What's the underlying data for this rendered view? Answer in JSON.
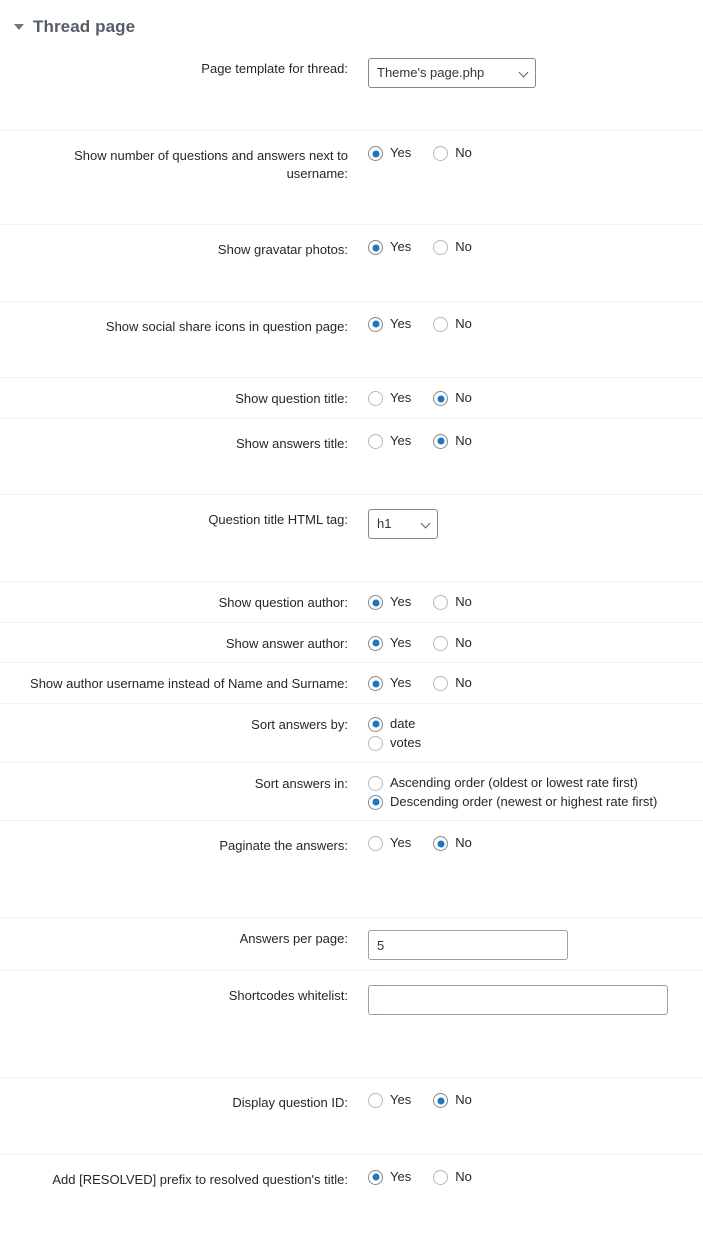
{
  "panel": {
    "title": "Thread page",
    "collapse_icon": "caret-down-icon"
  },
  "fields": {
    "page_template": {
      "label": "Page template for thread:",
      "value": "Theme's page.php",
      "options": [
        "Theme's page.php"
      ]
    },
    "show_counts": {
      "label": "Show number of questions and answers next to username:",
      "yes": "Yes",
      "no": "No",
      "selected": "Yes"
    },
    "show_gravatar": {
      "label": "Show gravatar photos:",
      "yes": "Yes",
      "no": "No",
      "selected": "Yes"
    },
    "show_social": {
      "label": "Show social share icons in question page:",
      "yes": "Yes",
      "no": "No",
      "selected": "Yes"
    },
    "show_question_title": {
      "label": "Show question title:",
      "yes": "Yes",
      "no": "No",
      "selected": "No"
    },
    "show_answers_title": {
      "label": "Show answers title:",
      "yes": "Yes",
      "no": "No",
      "selected": "No"
    },
    "title_tag": {
      "label": "Question title HTML tag:",
      "value": "h1",
      "options": [
        "h1"
      ]
    },
    "show_question_author": {
      "label": "Show question author:",
      "yes": "Yes",
      "no": "No",
      "selected": "Yes"
    },
    "show_answer_author": {
      "label": "Show answer author:",
      "yes": "Yes",
      "no": "No",
      "selected": "Yes"
    },
    "show_username": {
      "label": "Show author username instead of Name and Surname:",
      "yes": "Yes",
      "no": "No",
      "selected": "Yes"
    },
    "sort_answers_by": {
      "label": "Sort answers by:",
      "option_date": "date",
      "option_votes": "votes",
      "selected": "date"
    },
    "sort_answers_in": {
      "label": "Sort answers in:",
      "option_asc": "Ascending order (oldest or lowest rate first)",
      "option_desc": "Descending order (newest or highest rate first)",
      "selected": "Descending order (newest or highest rate first)"
    },
    "paginate": {
      "label": "Paginate the answers:",
      "yes": "Yes",
      "no": "No",
      "selected": "No"
    },
    "answers_per_page": {
      "label": "Answers per page:",
      "value": "5",
      "placeholder": ""
    },
    "shortcodes_whitelist": {
      "label": "Shortcodes whitelist:",
      "value": "",
      "placeholder": ""
    },
    "display_question_id": {
      "label": "Display question ID:",
      "yes": "Yes",
      "no": "No",
      "selected": "No"
    },
    "resolved_prefix": {
      "label": "Add [RESOLVED] prefix to resolved question's title:",
      "yes": "Yes",
      "no": "No",
      "selected": "Yes"
    }
  },
  "colors": {
    "accent": "#1d76c4",
    "title": "#555d66",
    "label": "#23282d",
    "rule": "#f1f1f1",
    "control_border": "#7e8993"
  }
}
